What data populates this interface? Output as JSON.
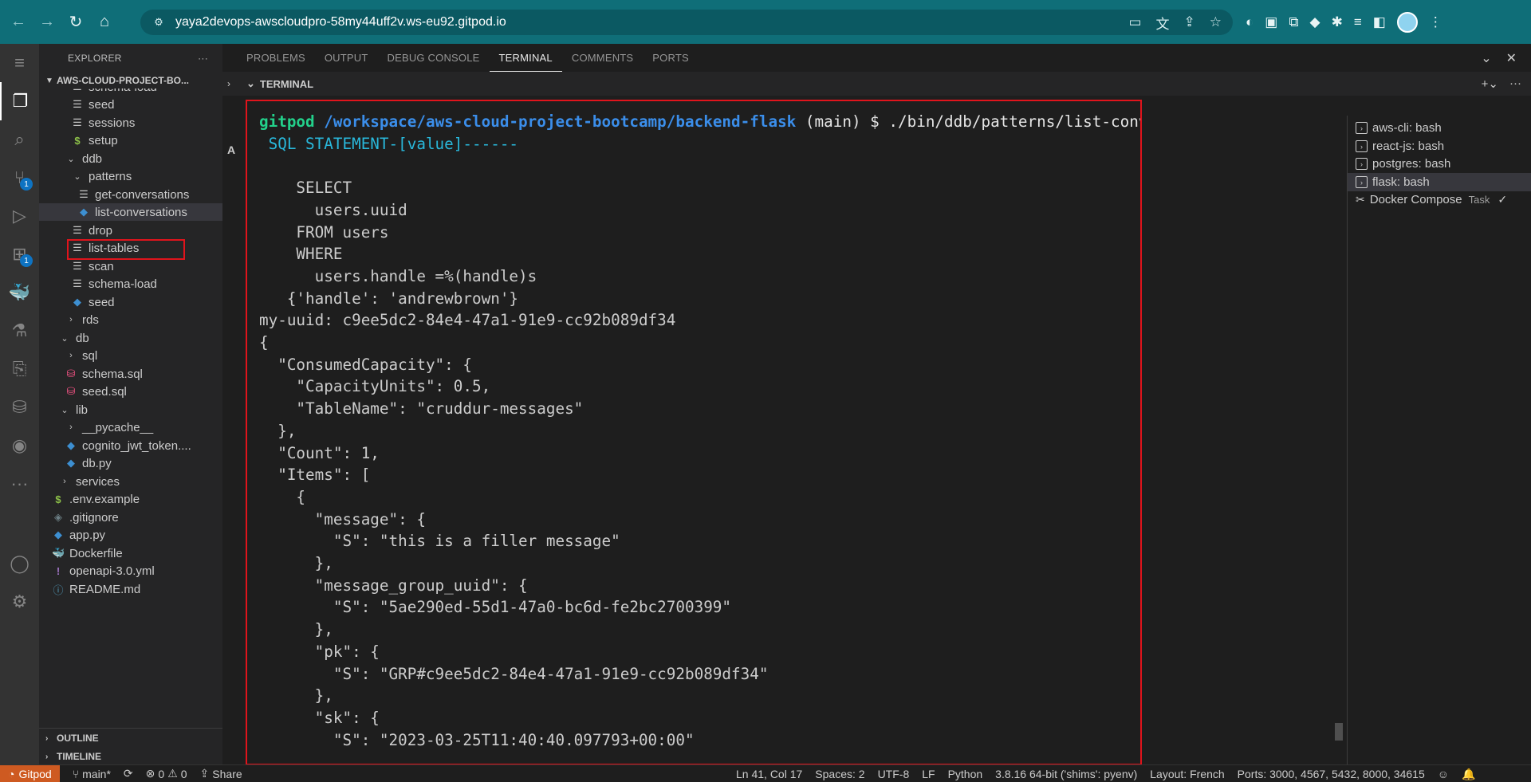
{
  "browser": {
    "url": "yaya2devops-awscloudpro-58my44uff2v.ws-eu92.gitpod.io"
  },
  "sidebar": {
    "title": "EXPLORER",
    "more": "···",
    "project": "AWS-CLOUD-PROJECT-BO...",
    "tree": [
      {
        "label": "schema-load",
        "icon": "file"
      },
      {
        "label": "seed",
        "icon": "file"
      },
      {
        "label": "sessions",
        "icon": "file"
      },
      {
        "label": "setup",
        "icon": "dollar"
      },
      {
        "label": "ddb",
        "icon": "chevron-down"
      },
      {
        "label": "patterns",
        "icon": "chevron-down"
      },
      {
        "label": "get-conversations",
        "icon": "file"
      },
      {
        "label": "list-conversations",
        "icon": "python"
      },
      {
        "label": "drop",
        "icon": "file"
      },
      {
        "label": "list-tables",
        "icon": "file"
      },
      {
        "label": "scan",
        "icon": "file"
      },
      {
        "label": "schema-load",
        "icon": "file"
      },
      {
        "label": "seed",
        "icon": "python"
      },
      {
        "label": "rds",
        "icon": "chevron-right"
      },
      {
        "label": "db",
        "icon": "chevron-down"
      },
      {
        "label": "sql",
        "icon": "chevron-right"
      },
      {
        "label": "schema.sql",
        "icon": "database"
      },
      {
        "label": "seed.sql",
        "icon": "database"
      },
      {
        "label": "lib",
        "icon": "chevron-down"
      },
      {
        "label": "__pycache__",
        "icon": "chevron-right"
      },
      {
        "label": "cognito_jwt_token....",
        "icon": "python"
      },
      {
        "label": "db.py",
        "icon": "python"
      },
      {
        "label": "services",
        "icon": "chevron-right"
      },
      {
        "label": ".env.example",
        "icon": "dollar"
      },
      {
        "label": ".gitignore",
        "icon": "git"
      },
      {
        "label": "app.py",
        "icon": "python"
      },
      {
        "label": "Dockerfile",
        "icon": "docker"
      },
      {
        "label": "openapi-3.0.yml",
        "icon": "yaml"
      },
      {
        "label": "README.md",
        "icon": "markdown"
      }
    ],
    "outline": "OUTLINE",
    "timeline": "TIMELINE"
  },
  "activity": {
    "scm_badge": "1",
    "ext_badge": "1"
  },
  "panel": {
    "tabs": [
      "PROBLEMS",
      "OUTPUT",
      "DEBUG CONSOLE",
      "TERMINAL",
      "COMMENTS",
      "PORTS"
    ],
    "active_tab": "TERMINAL",
    "terminal_label": "TERMINAL"
  },
  "terminal": {
    "prompt_user": "gitpod",
    "prompt_path": "/workspace/aws-cloud-project-bootcamp/backend-flask",
    "prompt_branch": " (main) $ ./bin/ddb/patterns/list-conversations",
    "sql_header": " SQL STATEMENT-[value]------",
    "lines": [
      "",
      "    SELECT",
      "      users.uuid",
      "    FROM users",
      "    WHERE",
      "      users.handle =%(handle)s",
      "   {'handle': 'andrewbrown'}",
      "my-uuid: c9ee5dc2-84e4-47a1-91e9-cc92b089df34",
      "{",
      "  \"ConsumedCapacity\": {",
      "    \"CapacityUnits\": 0.5,",
      "    \"TableName\": \"cruddur-messages\"",
      "  },",
      "  \"Count\": 1,",
      "  \"Items\": [",
      "    {",
      "      \"message\": {",
      "        \"S\": \"this is a filler message\"",
      "      },",
      "      \"message_group_uuid\": {",
      "        \"S\": \"5ae290ed-55d1-47a0-bc6d-fe2bc2700399\"",
      "      },",
      "      \"pk\": {",
      "        \"S\": \"GRP#c9ee5dc2-84e4-47a1-91e9-cc92b089df34\"",
      "      },",
      "      \"sk\": {",
      "        \"S\": \"2023-03-25T11:40:40.097793+00:00\""
    ]
  },
  "terminal_list": [
    {
      "label": "aws-cli: bash"
    },
    {
      "label": "react-js: bash"
    },
    {
      "label": "postgres: bash"
    },
    {
      "label": "flask: bash"
    },
    {
      "label": "Docker Compose",
      "task": "Task"
    }
  ],
  "statusbar": {
    "gitpod": "Gitpod",
    "branch": "main*",
    "errors": "0",
    "warnings": "0",
    "share": "Share",
    "position": "Ln 41, Col 17",
    "spaces": "Spaces: 2",
    "encoding": "UTF-8",
    "eol": "LF",
    "language": "Python",
    "interpreter": "3.8.16 64-bit ('shims': pyenv)",
    "layout": "Layout: French",
    "ports": "Ports: 3000, 4567, 5432, 8000, 34615"
  }
}
